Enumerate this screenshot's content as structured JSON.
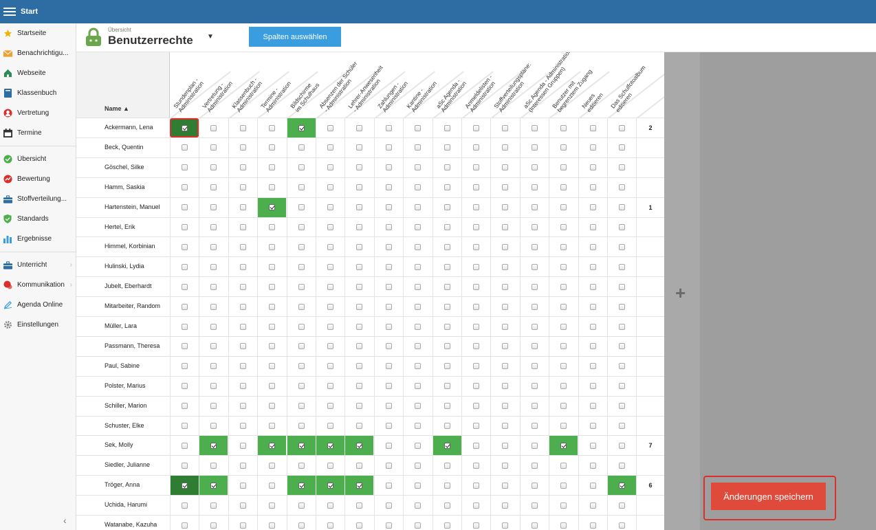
{
  "topbar": {
    "title": "Start"
  },
  "sidebar": {
    "group1": [
      {
        "label": "Startseite",
        "icon": "star-icon",
        "color": "#f0b400"
      },
      {
        "label": "Benachrichtigu...",
        "icon": "envelope-icon",
        "color": "#f0a030"
      },
      {
        "label": "Webseite",
        "icon": "home-icon",
        "color": "#2e8b57"
      },
      {
        "label": "Klassenbuch",
        "icon": "book-icon",
        "color": "#2e6da4"
      },
      {
        "label": "Vertretung",
        "icon": "person-icon",
        "color": "#d9302c"
      },
      {
        "label": "Termine",
        "icon": "calendar-icon",
        "color": "#333"
      }
    ],
    "group2": [
      {
        "label": "Übersicht",
        "icon": "check-circle-icon",
        "color": "#4cae4c"
      },
      {
        "label": "Bewertung",
        "icon": "chart-circle-icon",
        "color": "#d9302c"
      },
      {
        "label": "Stoffverteilung...",
        "icon": "briefcase-icon",
        "color": "#2e6da4"
      },
      {
        "label": "Standards",
        "icon": "shield-icon",
        "color": "#4cae4c"
      },
      {
        "label": "Ergebnisse",
        "icon": "bar-chart-icon",
        "color": "#3a9de0"
      }
    ],
    "group3": [
      {
        "label": "Unterricht",
        "icon": "briefcase-icon",
        "color": "#2e6da4",
        "chevron": true
      },
      {
        "label": "Kommunikation",
        "icon": "chat-icon",
        "color": "#d9302c",
        "chevron": true
      },
      {
        "label": "Agenda Online",
        "icon": "pen-icon",
        "color": "#3a9de0"
      },
      {
        "label": "Einstellungen",
        "icon": "gear-icon",
        "color": "#888"
      }
    ]
  },
  "header": {
    "subtitle": "Übersicht",
    "title": "Benutzerrechte",
    "columns_button": "Spalten auswählen"
  },
  "table": {
    "name_header": "Name ▲",
    "columns": [
      [
        "Stundenplan -",
        "Administration"
      ],
      [
        "Vertretung -",
        "Administration"
      ],
      [
        "Klassenbuch -",
        "Administration"
      ],
      [
        "Termine -",
        "Administration"
      ],
      [
        "Bildschirme",
        "im Schulhaus"
      ],
      [
        "Absenzen der Schüler",
        "- Administration"
      ],
      [
        "Lehrer-Anwesenheit",
        "- Administration"
      ],
      [
        "Zahlungen -",
        "Administration"
      ],
      [
        "Kantine -",
        "Administration"
      ],
      [
        "aSc Agenda -",
        "Administration"
      ],
      [
        "Anmeldelisten -",
        "Administration"
      ],
      [
        "Stoffverteilungspläne:",
        "Administration"
      ],
      [
        "aSc Agenda - Administration",
        "(Interessen Gruppen)"
      ],
      [
        "Benutzer mit",
        "begrenztem Zugang"
      ],
      [
        "Neues",
        "editieren"
      ],
      [
        "Das Schulfotoalbum",
        "editieren"
      ]
    ],
    "rows": [
      {
        "name": "Ackermann, Lena",
        "checked": [
          0,
          4
        ],
        "count": "2"
      },
      {
        "name": "Beck, Quentin",
        "checked": [],
        "count": ""
      },
      {
        "name": "Göschel, Silke",
        "checked": [],
        "count": ""
      },
      {
        "name": "Hamm, Saskia",
        "checked": [],
        "count": ""
      },
      {
        "name": "Hartenstein, Manuel",
        "checked": [
          3
        ],
        "count": "1"
      },
      {
        "name": "Hertel, Erik",
        "checked": [],
        "count": ""
      },
      {
        "name": "Himmel, Korbinian",
        "checked": [],
        "count": ""
      },
      {
        "name": "Hulinski, Lydia",
        "checked": [],
        "count": ""
      },
      {
        "name": "Jubelt, Eberhardt",
        "checked": [],
        "count": ""
      },
      {
        "name": "Mitarbeiter, Random",
        "checked": [],
        "count": ""
      },
      {
        "name": "Müller, Lara",
        "checked": [],
        "count": ""
      },
      {
        "name": "Passmann, Theresa",
        "checked": [],
        "count": ""
      },
      {
        "name": "Paul, Sabine",
        "checked": [],
        "count": ""
      },
      {
        "name": "Polster, Marius",
        "checked": [],
        "count": ""
      },
      {
        "name": "Schiller, Marion",
        "checked": [],
        "count": ""
      },
      {
        "name": "Schuster, Elke",
        "checked": [],
        "count": ""
      },
      {
        "name": "Sek, Molly",
        "checked": [
          1,
          3,
          4,
          5,
          6,
          9,
          13
        ],
        "count": "7"
      },
      {
        "name": "Siedler, Julianne",
        "checked": [],
        "count": ""
      },
      {
        "name": "Tröger, Anna",
        "checked": [
          0,
          1,
          4,
          5,
          6,
          15
        ],
        "count": "6"
      },
      {
        "name": "Uchida, Harumi",
        "checked": [],
        "count": ""
      },
      {
        "name": "Watanabe, Kazuha",
        "checked": [],
        "count": ""
      }
    ]
  },
  "actions": {
    "add_symbol": "+",
    "save_label": "Änderungen speichern"
  },
  "colors": {
    "topbar": "#2e6da4",
    "checked_cell": "#4cae4c",
    "save_button": "#e04a3a",
    "highlight": "#d9302c"
  }
}
